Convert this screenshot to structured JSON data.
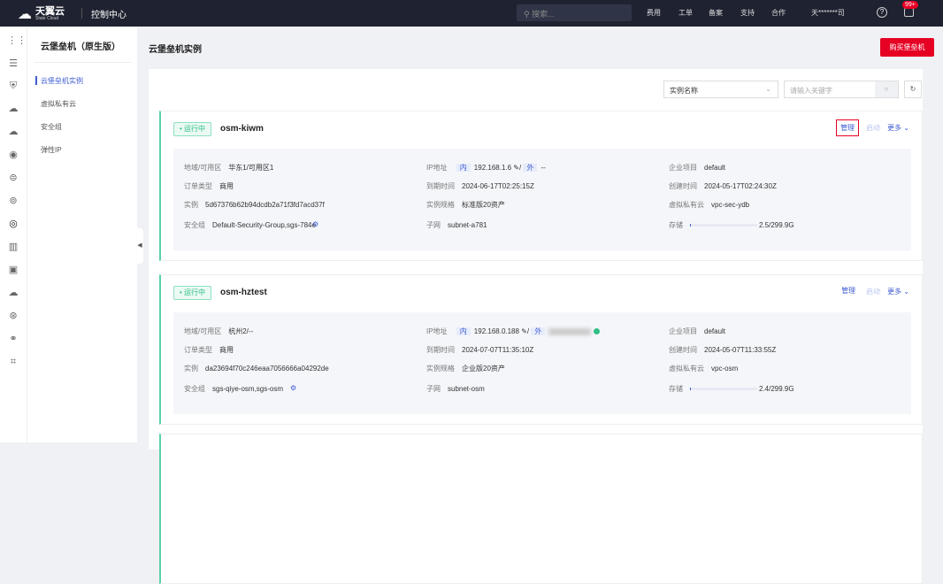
{
  "header": {
    "logo_title": "天翼云",
    "logo_sub": "State Cloud",
    "console": "控制中心",
    "search_placeholder": "搜索...",
    "nav": [
      "费用",
      "工单",
      "备案",
      "支持",
      "合作"
    ],
    "user": "天*******司",
    "badge": "99+"
  },
  "sidebar": {
    "title": "云堡垒机（原生版）",
    "items": [
      "云堡垒机实例",
      "虚拟私有云",
      "安全组",
      "弹性IP"
    ]
  },
  "page": {
    "title": "云堡垒机实例",
    "buy_label": "购买堡垒机"
  },
  "filter": {
    "select_value": "实例名称",
    "keyword_placeholder": "请输入关键字"
  },
  "labels": {
    "region": "地域/可用区",
    "order": "订单类型",
    "instance": "实例",
    "sg": "安全组",
    "ip": "IP地址",
    "expire": "到期时间",
    "spec": "实例规格",
    "subnet": "子网",
    "project": "企业项目",
    "created": "创建时间",
    "vpc": "虚拟私有云",
    "storage": "存储",
    "inner": "内",
    "outer": "外",
    "manage": "管理",
    "start": "启动",
    "more": "更多"
  },
  "instances": [
    {
      "status": "运行中",
      "name": "osm-kiwm",
      "region": "华东1/可用区1",
      "order": "商用",
      "id": "5d67376b62b94dcdb2a71f3fd7acd37f",
      "sg": "Default-Security-Group,sgs-784e",
      "ip_inner": "192.168.1.6",
      "ip_outer": "--",
      "expire": "2024-06-17T02:25:15Z",
      "spec": "标准版20资产",
      "subnet": "subnet-a781",
      "project": "default",
      "created": "2024-05-17T02:24:30Z",
      "vpc": "vpc-sec-ydb",
      "storage": "2.5/299.9G",
      "storage_used_fraction": 0.008
    },
    {
      "status": "运行中",
      "name": "osm-hztest",
      "region": "杭州2/--",
      "order": "商用",
      "id": "da23694f70c246eaa7056666a04292de",
      "sg": "sgs-qiye-osm,sgs-osm",
      "ip_inner": "192.168.0.188",
      "expire": "2024-07-07T11:35:10Z",
      "spec": "企业版20资产",
      "subnet": "subnet-osm",
      "project": "default",
      "created": "2024-05-07T11:33:55Z",
      "vpc": "vpc-osm",
      "storage": "2.4/299.9G",
      "storage_used_fraction": 0.008
    }
  ]
}
